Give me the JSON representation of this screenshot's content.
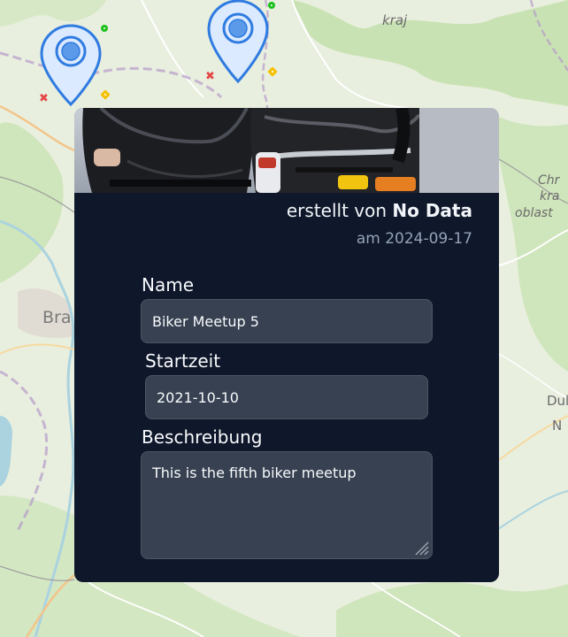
{
  "map": {
    "labels": [
      "kraj",
      "Chr",
      "kra",
      "oblast",
      "Bra",
      "Dul",
      "N"
    ]
  },
  "markers": {
    "large": [
      "location-marker",
      "location-marker"
    ],
    "small_colors": {
      "green": "#1cc11c",
      "yellow": "#f4c000",
      "red": "#e44848"
    }
  },
  "popup": {
    "creator_prefix": "erstellt von",
    "creator_name": "No Data",
    "created_date": "am 2024-09-17",
    "name_label": "Name",
    "name_value": "Biker Meetup 5",
    "start_label": "Startzeit",
    "start_value": "2021-10-10",
    "description_label": "Beschreibung",
    "description_value": "This is the fifth biker meetup"
  },
  "colors": {
    "card_bg": "#0f172a",
    "field_bg": "#374151",
    "marker_blue": "#2f7be0"
  }
}
